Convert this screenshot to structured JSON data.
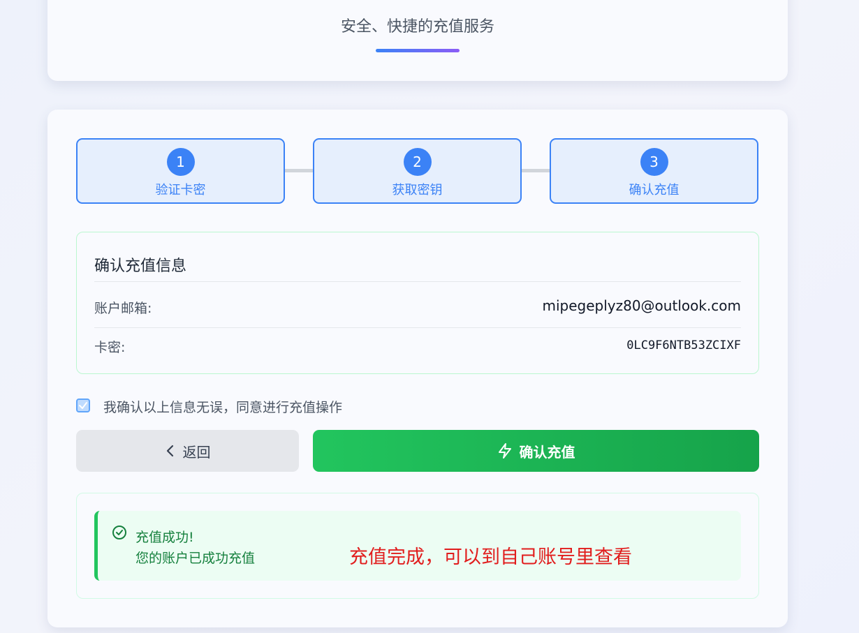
{
  "header": {
    "title": "",
    "subtitle": "安全、快捷的充值服务"
  },
  "steps": [
    {
      "number": "1",
      "label": "验证卡密"
    },
    {
      "number": "2",
      "label": "获取密钥"
    },
    {
      "number": "3",
      "label": "确认充值"
    }
  ],
  "info": {
    "title": "确认充值信息",
    "email_label": "账户邮箱:",
    "email_value": "mipegeplyz80@outlook.com",
    "card_label": "卡密:",
    "card_value": "0LC9F6NTB53ZCIXF"
  },
  "confirm": {
    "checked": true,
    "text": "我确认以上信息无误，同意进行充值操作"
  },
  "buttons": {
    "back_label": "返回",
    "confirm_label": "确认充值"
  },
  "result": {
    "title": "充值成功!",
    "description": "您的账户已成功充值",
    "note": "充值完成，可以到自己账号里查看"
  },
  "colors": {
    "primary": "#3b82f6",
    "success": "#22c55e",
    "accent_purple": "#8b5cf6",
    "note_red": "#e11d1d"
  }
}
